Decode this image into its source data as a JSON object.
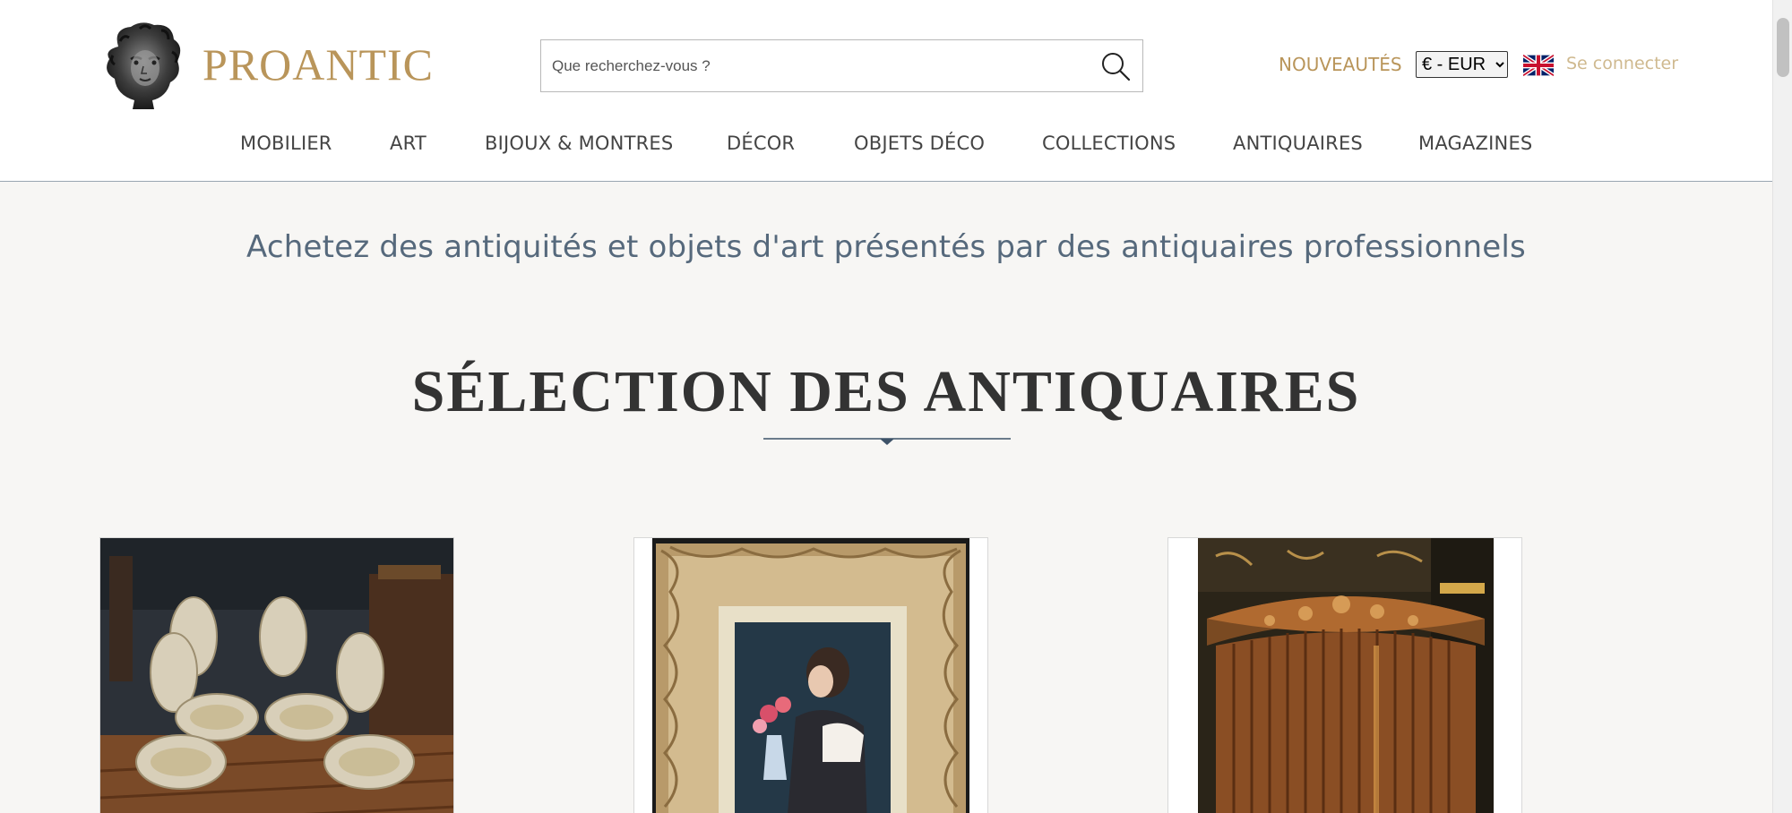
{
  "header": {
    "logo_text": "PROANTIC",
    "search_placeholder": "Que recherchez-vous ?",
    "nouveautes_label": "NOUVEAUTÉS",
    "currency_selected": "€ - EUR",
    "login_label": "Se connecter",
    "language_icon": "uk-flag-icon",
    "search_icon": "search-icon"
  },
  "nav": {
    "items": [
      {
        "label": "MOBILIER"
      },
      {
        "label": "ART"
      },
      {
        "label": "BIJOUX & MONTRES"
      },
      {
        "label": "DÉCOR"
      },
      {
        "label": "OBJETS DÉCO"
      },
      {
        "label": "COLLECTIONS"
      },
      {
        "label": "ANTIQUAIRES"
      },
      {
        "label": "MAGAZINES"
      }
    ]
  },
  "main": {
    "tagline": "Achetez des antiquités et objets d'art présentés par des antiquaires professionnels",
    "section_title": "SÉLECTION DES ANTIQUAIRES",
    "products": [
      {
        "image": "salon-chairs-photo"
      },
      {
        "image": "framed-painting-photo"
      },
      {
        "image": "demilune-cabinet-photo"
      }
    ]
  },
  "colors": {
    "brand_gold": "#b9955a",
    "login_gold": "#cfb98f",
    "tagline_slate": "#56697c",
    "rule_navy": "#3d5268",
    "page_background": "#f7f6f4"
  }
}
